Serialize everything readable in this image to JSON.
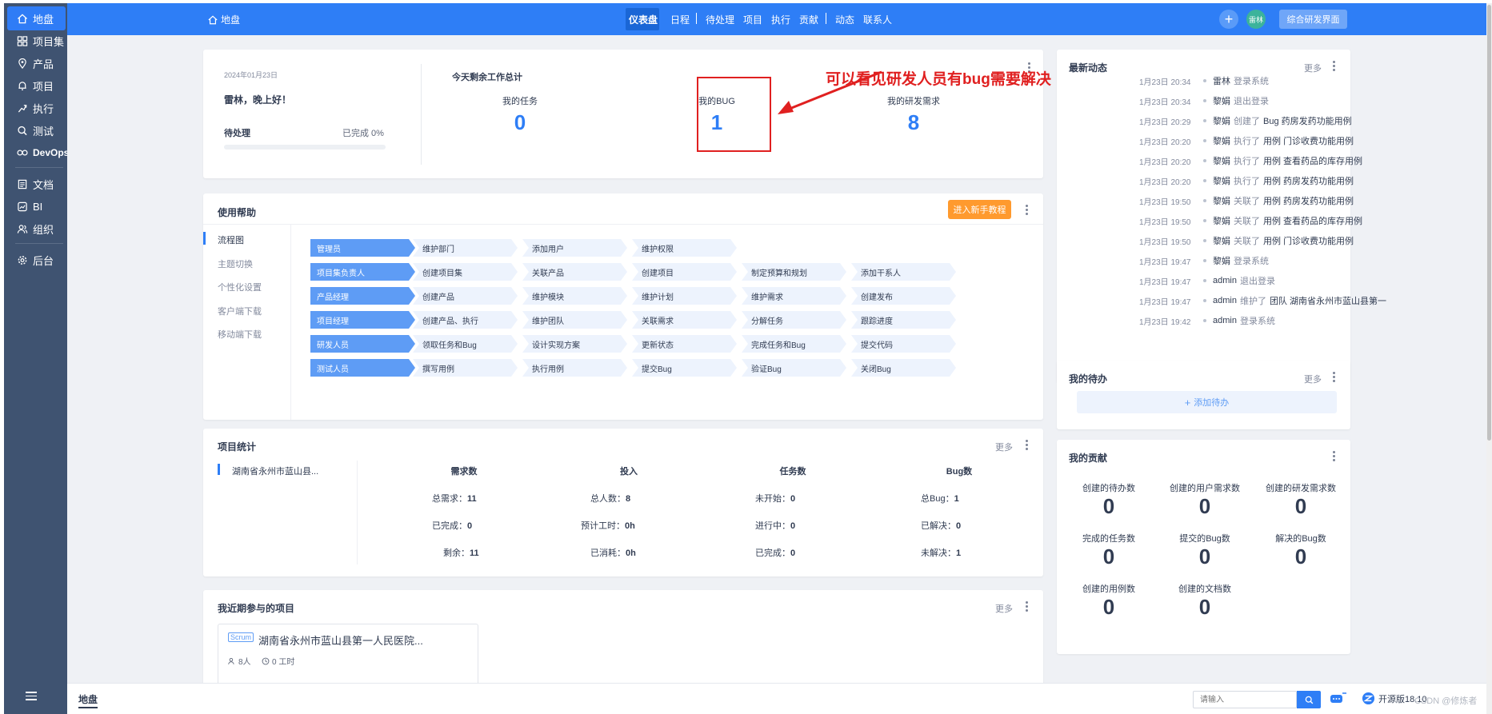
{
  "sidebar": {
    "items": [
      {
        "label": "地盘",
        "icon": "home-icon"
      },
      {
        "label": "项目集",
        "icon": "grid-icon"
      },
      {
        "label": "产品",
        "icon": "location-icon"
      },
      {
        "label": "项目",
        "icon": "bell-icon"
      },
      {
        "label": "执行",
        "icon": "run-icon"
      },
      {
        "label": "测试",
        "icon": "search-icon"
      },
      {
        "label": "DevOps",
        "icon": "infinity-icon"
      },
      {
        "label": "文档",
        "icon": "doc-icon"
      },
      {
        "label": "BI",
        "icon": "chart-icon"
      },
      {
        "label": "组织",
        "icon": "people-icon"
      },
      {
        "label": "后台",
        "icon": "gear-icon"
      }
    ]
  },
  "topbar": {
    "breadcrumb": "地盘",
    "nav": [
      "仪表盘",
      "日程",
      "待处理",
      "项目",
      "执行",
      "贡献",
      "动态",
      "联系人"
    ],
    "avatar": "雷林",
    "switch_button": "综合研发界面"
  },
  "welcome": {
    "date": "2024年01月23日",
    "greeting": "雷林，晚上好！",
    "todo_label": "待处理",
    "done_label": "已完成 0%",
    "progress": 0
  },
  "today": {
    "title": "今天剩余工作总计",
    "stats": [
      {
        "label": "我的任务",
        "value": "0"
      },
      {
        "label": "我的BUG",
        "value": "1"
      },
      {
        "label": "我的研发需求",
        "value": "8"
      }
    ]
  },
  "annotation": {
    "text": "可以看见研发人员有bug需要解决"
  },
  "help": {
    "title": "使用帮助",
    "tutorial_button": "进入新手教程",
    "menu": [
      "流程图",
      "主题切换",
      "个性化设置",
      "客户端下载",
      "移动端下载"
    ],
    "rows": [
      {
        "role": "管理员",
        "steps": [
          "维护部门",
          "添加用户",
          "维护权限"
        ]
      },
      {
        "role": "项目集负责人",
        "steps": [
          "创建项目集",
          "关联产品",
          "创建项目",
          "制定预算和规划",
          "添加干系人"
        ]
      },
      {
        "role": "产品经理",
        "steps": [
          "创建产品",
          "维护模块",
          "维护计划",
          "维护需求",
          "创建发布"
        ]
      },
      {
        "role": "项目经理",
        "steps": [
          "创建产品、执行",
          "维护团队",
          "关联需求",
          "分解任务",
          "跟踪进度"
        ]
      },
      {
        "role": "研发人员",
        "steps": [
          "领取任务和Bug",
          "设计实现方案",
          "更新状态",
          "完成任务和Bug",
          "提交代码"
        ]
      },
      {
        "role": "测试人员",
        "steps": [
          "撰写用例",
          "执行用例",
          "提交Bug",
          "验证Bug",
          "关闭Bug"
        ]
      }
    ]
  },
  "project_stats": {
    "title": "项目统计",
    "more": "更多",
    "project": "湖南省永州市蓝山县...",
    "cols": [
      {
        "head": "需求数",
        "rows": [
          [
            "总需求：",
            "11"
          ],
          [
            "已完成：",
            "0"
          ],
          [
            "剩余：",
            "11"
          ]
        ]
      },
      {
        "head": "投入",
        "rows": [
          [
            "总人数：",
            "8"
          ],
          [
            "预计工时：",
            "0h"
          ],
          [
            "已消耗：",
            "0h"
          ]
        ]
      },
      {
        "head": "任务数",
        "rows": [
          [
            "未开始：",
            "0"
          ],
          [
            "进行中：",
            "0"
          ],
          [
            "已完成：",
            "0"
          ]
        ]
      },
      {
        "head": "Bug数",
        "rows": [
          [
            "总Bug：",
            "1"
          ],
          [
            "已解决：",
            "0"
          ],
          [
            "未解决：",
            "1"
          ]
        ]
      }
    ]
  },
  "recent": {
    "title": "我近期参与的项目",
    "more": "更多",
    "badge": "Scrum",
    "name": "湖南省永州市蓝山县第一人民医院...",
    "people": "8人",
    "hours": "0 工时"
  },
  "dynamics": {
    "title": "最新动态",
    "more": "更多",
    "items": [
      {
        "time": "1月23日 20:34",
        "user": "雷林",
        "action": "登录系统",
        "obj": ""
      },
      {
        "time": "1月23日 20:34",
        "user": "黎娟",
        "action": "退出登录",
        "obj": ""
      },
      {
        "time": "1月23日 20:29",
        "user": "黎娟",
        "action": "创建了",
        "obj": "Bug  药房发药功能用例"
      },
      {
        "time": "1月23日 20:20",
        "user": "黎娟",
        "action": "执行了",
        "obj": "用例  门诊收费功能用例"
      },
      {
        "time": "1月23日 20:20",
        "user": "黎娟",
        "action": "执行了",
        "obj": "用例  查看药品的库存用例"
      },
      {
        "time": "1月23日 20:20",
        "user": "黎娟",
        "action": "执行了",
        "obj": "用例  药房发药功能用例"
      },
      {
        "time": "1月23日 19:50",
        "user": "黎娟",
        "action": "关联了",
        "obj": "用例  药房发药功能用例"
      },
      {
        "time": "1月23日 19:50",
        "user": "黎娟",
        "action": "关联了",
        "obj": "用例  查看药品的库存用例"
      },
      {
        "time": "1月23日 19:50",
        "user": "黎娟",
        "action": "关联了",
        "obj": "用例  门诊收费功能用例"
      },
      {
        "time": "1月23日 19:47",
        "user": "黎娟",
        "action": "登录系统",
        "obj": ""
      },
      {
        "time": "1月23日 19:47",
        "user": "admin",
        "action": "退出登录",
        "obj": ""
      },
      {
        "time": "1月23日 19:47",
        "user": "admin",
        "action": "维护了",
        "obj": "团队  湖南省永州市蓝山县第一"
      },
      {
        "time": "1月23日 19:42",
        "user": "admin",
        "action": "登录系统",
        "obj": ""
      }
    ]
  },
  "todo": {
    "title": "我的待办",
    "more": "更多",
    "add": "添加待办"
  },
  "contrib": {
    "title": "我的贡献",
    "items": [
      {
        "label": "创建的待办数",
        "value": "0"
      },
      {
        "label": "创建的用户需求数",
        "value": "0"
      },
      {
        "label": "创建的研发需求数",
        "value": "0"
      },
      {
        "label": "完成的任务数",
        "value": "0"
      },
      {
        "label": "提交的Bug数",
        "value": "0"
      },
      {
        "label": "解决的Bug数",
        "value": "0"
      },
      {
        "label": "创建的用例数",
        "value": "0"
      },
      {
        "label": "创建的文档数",
        "value": "0"
      }
    ]
  },
  "bottom": {
    "tab": "地盘",
    "search_placeholder": "请输入",
    "brand": "开源版18.10",
    "watermark": "CSDN @修炼者"
  },
  "colors": {
    "primary": "#2e7ef6",
    "sidebar": "#3f5371",
    "accent_red": "#e02020",
    "orange": "#ff9a2e"
  }
}
